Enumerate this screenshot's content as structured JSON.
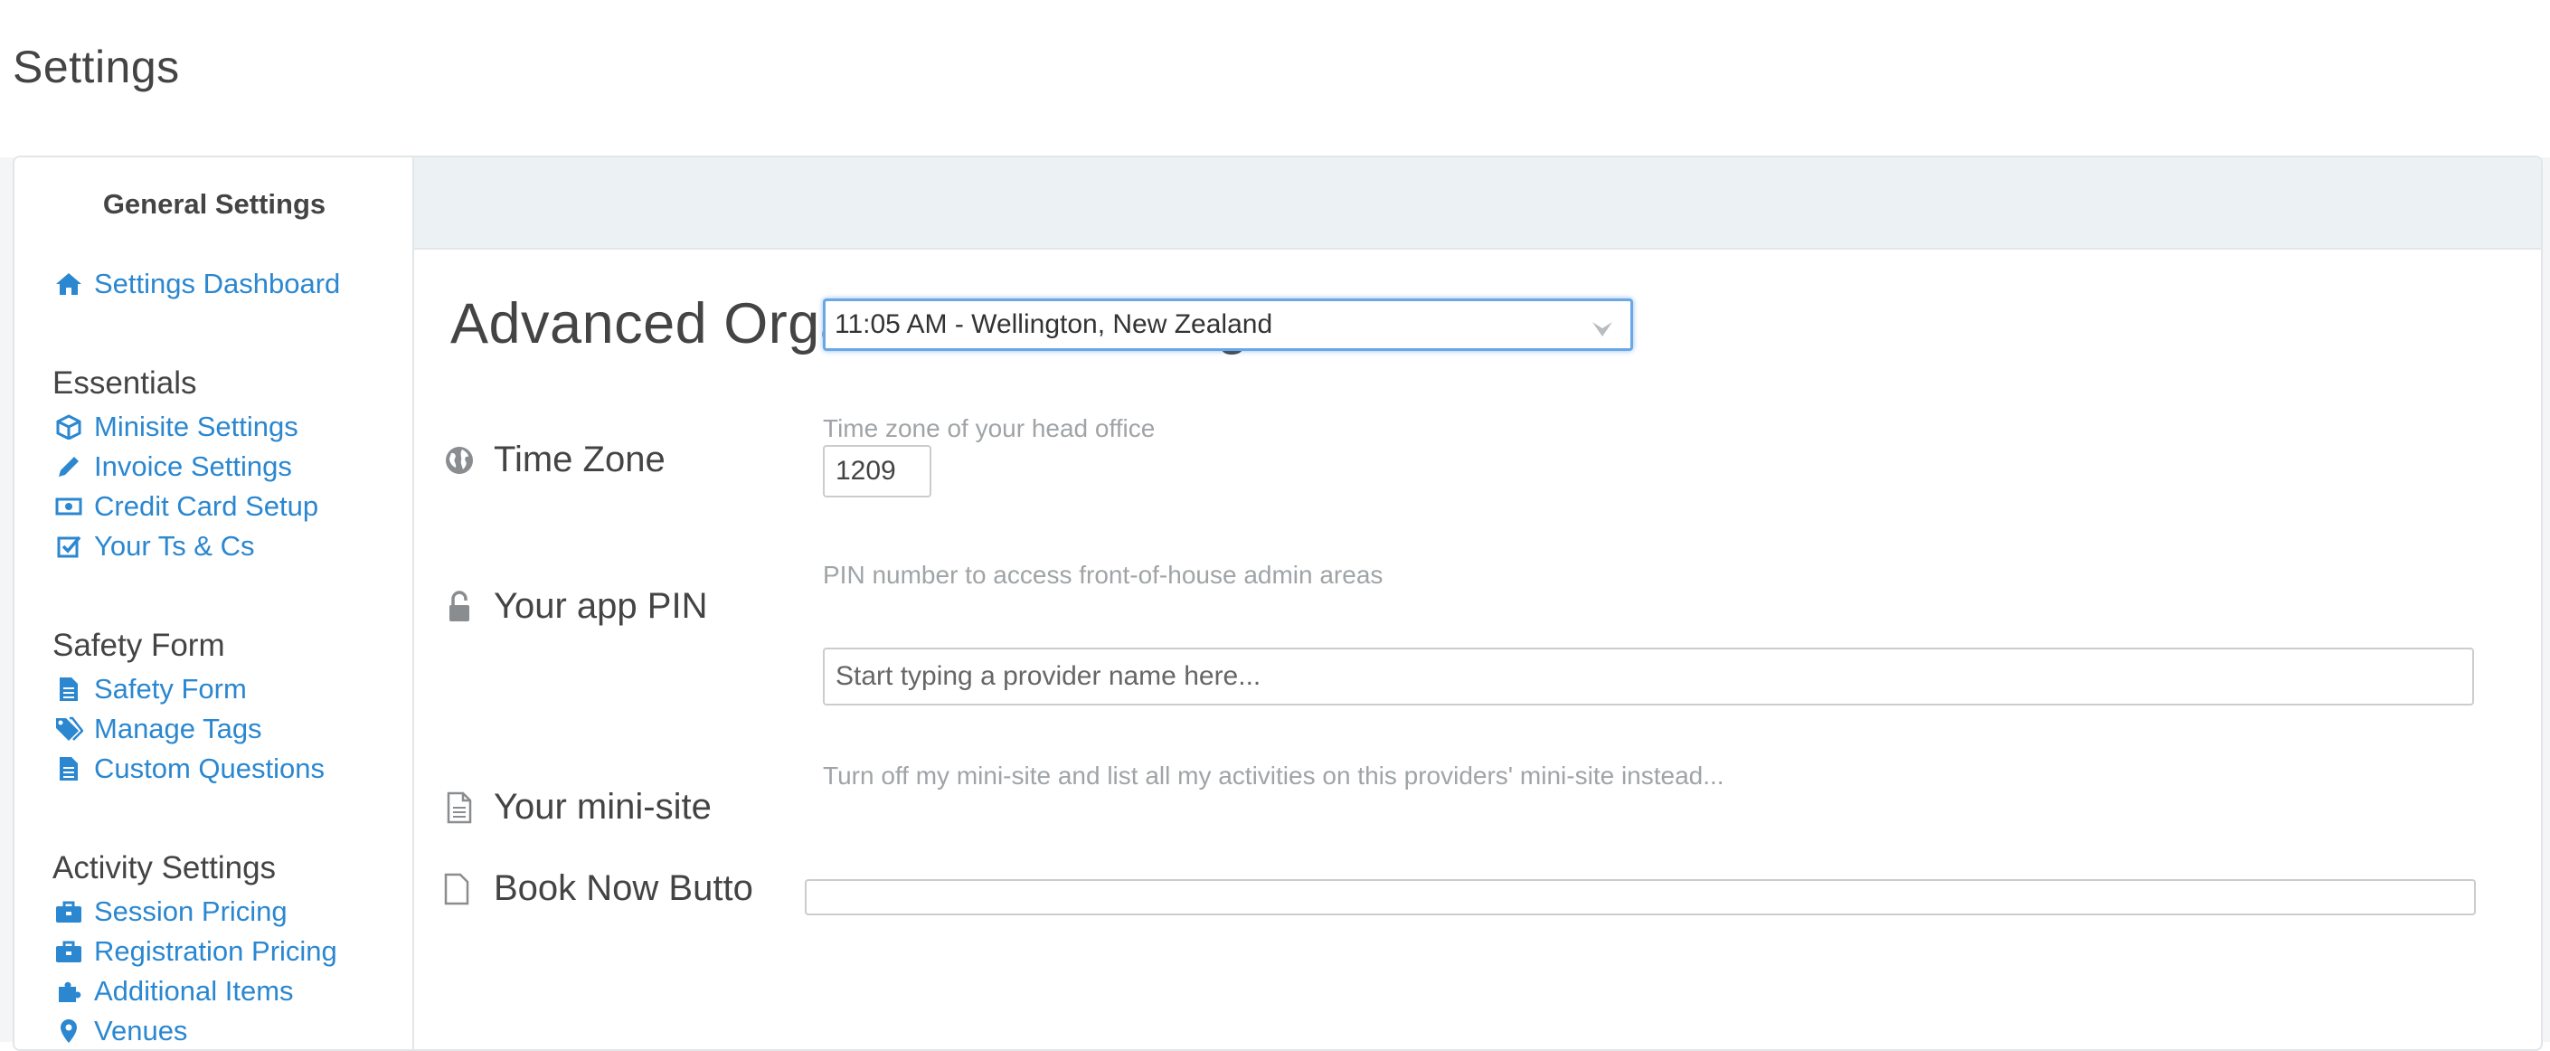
{
  "page": {
    "title": "Settings"
  },
  "sidebar": {
    "heading": "General Settings",
    "dashboard": {
      "label": "Settings Dashboard",
      "icon": "home-icon"
    },
    "sections": [
      {
        "title": "Essentials",
        "items": [
          {
            "label": "Minisite Settings",
            "icon": "cube-icon"
          },
          {
            "label": "Invoice Settings",
            "icon": "pencil-icon"
          },
          {
            "label": "Credit Card Setup",
            "icon": "money-icon"
          },
          {
            "label": "Your Ts & Cs",
            "icon": "checkbox-icon"
          }
        ]
      },
      {
        "title": "Safety Form",
        "items": [
          {
            "label": "Safety Form",
            "icon": "document-icon"
          },
          {
            "label": "Manage Tags",
            "icon": "tags-icon"
          },
          {
            "label": "Custom Questions",
            "icon": "document-icon"
          }
        ]
      },
      {
        "title": "Activity Settings",
        "items": [
          {
            "label": "Session Pricing",
            "icon": "briefcase-icon"
          },
          {
            "label": "Registration Pricing",
            "icon": "briefcase-icon"
          },
          {
            "label": "Additional Items",
            "icon": "puzzle-icon"
          },
          {
            "label": "Venues",
            "icon": "map-marker-icon"
          }
        ]
      }
    ]
  },
  "main": {
    "title": "Advanced Organisation Settings",
    "time_zone": {
      "label": "Time Zone",
      "icon": "globe-icon",
      "help": "Time zone of your head office",
      "value": "11:05 AM - Wellington, New Zealand"
    },
    "app_pin": {
      "label": "Your app PIN",
      "icon": "unlock-icon",
      "help": "PIN number to access front-of-house admin areas",
      "value": "1209"
    },
    "mini_site": {
      "label": "Your mini-site",
      "icon": "file-icon",
      "help": "Turn off my mini-site and list all my activities on this providers' mini-site instead...",
      "placeholder": "Start typing a provider name here..."
    },
    "book_now": {
      "label": "Book Now Butto",
      "icon": "file-icon"
    }
  },
  "colors": {
    "link": "#2a87d0",
    "focus_border": "#6aa7e6",
    "header_strip": "#ecf2f3"
  }
}
